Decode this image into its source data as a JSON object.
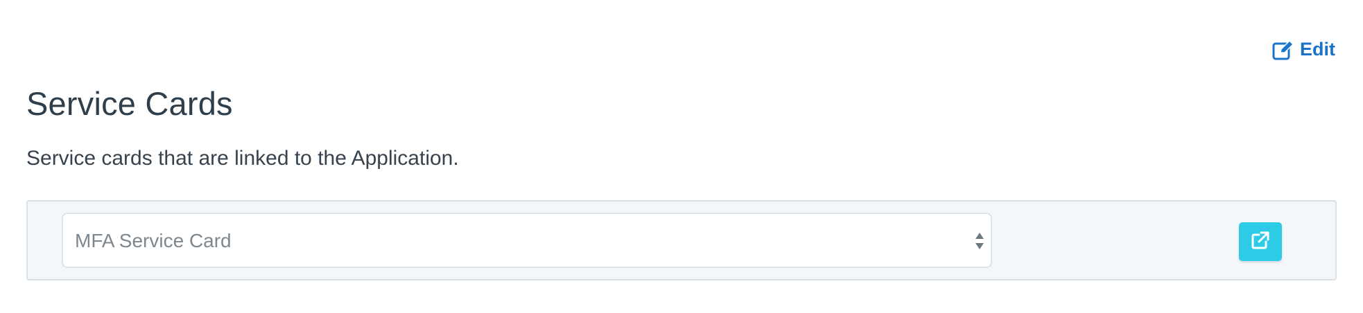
{
  "header": {
    "edit_label": "Edit",
    "title": "Service Cards",
    "subtitle": "Service cards that are linked to the Application."
  },
  "service_card": {
    "selected_value": "MFA Service Card",
    "open_button_icon": "external-link-icon"
  },
  "colors": {
    "link": "#1a73c9",
    "title_text": "#2f3e4b",
    "panel_background": "#f4f7fa",
    "panel_border": "#d9e1e8",
    "open_button": "#2ecbe6"
  }
}
